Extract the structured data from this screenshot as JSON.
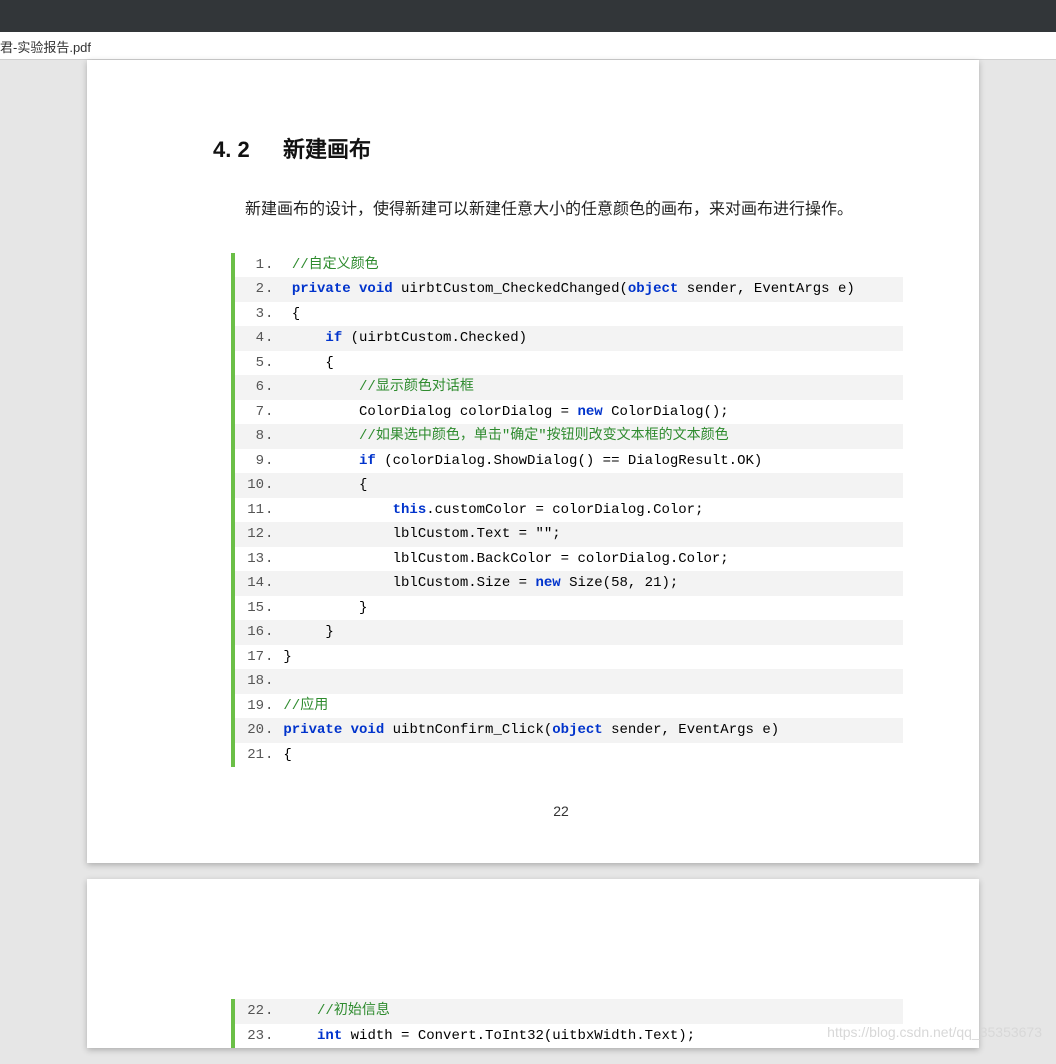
{
  "tab": {
    "filename_fragment": "君-实验报告.pdf"
  },
  "doc": {
    "section": {
      "number": "4. 2",
      "title": "新建画布"
    },
    "paragraph": "新建画布的设计，使得新建可以新建任意大小的任意颜色的画布，来对画布进行操作。",
    "page_number": "22",
    "code1": [
      {
        "n": "1",
        "alt": false,
        "tokens": [
          [
            "pl",
            "  "
          ],
          [
            "cm",
            "//自定义颜色"
          ]
        ]
      },
      {
        "n": "2",
        "alt": true,
        "tokens": [
          [
            "pl",
            "  "
          ],
          [
            "kw",
            "private"
          ],
          [
            "pl",
            " "
          ],
          [
            "kw",
            "void"
          ],
          [
            "pl",
            " uirbtCustom_CheckedChanged("
          ],
          [
            "kw",
            "object"
          ],
          [
            "pl",
            " sender, EventArgs e)"
          ]
        ]
      },
      {
        "n": "3",
        "alt": false,
        "tokens": [
          [
            "pl",
            "  {"
          ]
        ]
      },
      {
        "n": "4",
        "alt": true,
        "tokens": [
          [
            "pl",
            "      "
          ],
          [
            "kw",
            "if"
          ],
          [
            "pl",
            " (uirbtCustom.Checked)"
          ]
        ]
      },
      {
        "n": "5",
        "alt": false,
        "tokens": [
          [
            "pl",
            "      {"
          ]
        ]
      },
      {
        "n": "6",
        "alt": true,
        "tokens": [
          [
            "pl",
            "          "
          ],
          [
            "cm",
            "//显示颜色对话框"
          ]
        ]
      },
      {
        "n": "7",
        "alt": false,
        "tokens": [
          [
            "pl",
            "          ColorDialog colorDialog = "
          ],
          [
            "kw",
            "new"
          ],
          [
            "pl",
            " ColorDialog();"
          ]
        ]
      },
      {
        "n": "8",
        "alt": true,
        "tokens": [
          [
            "pl",
            "          "
          ],
          [
            "cm",
            "//如果选中颜色，单击\"确定\"按钮则改变文本框的文本颜色"
          ]
        ]
      },
      {
        "n": "9",
        "alt": false,
        "tokens": [
          [
            "pl",
            "          "
          ],
          [
            "kw",
            "if"
          ],
          [
            "pl",
            " (colorDialog.ShowDialog() == DialogResult.OK)"
          ]
        ]
      },
      {
        "n": "10",
        "alt": true,
        "tokens": [
          [
            "pl",
            "          {"
          ]
        ]
      },
      {
        "n": "11",
        "alt": false,
        "tokens": [
          [
            "pl",
            "              "
          ],
          [
            "kw",
            "this"
          ],
          [
            "pl",
            ".customColor = colorDialog.Color;"
          ]
        ]
      },
      {
        "n": "12",
        "alt": true,
        "tokens": [
          [
            "pl",
            "              lblCustom.Text = \"\";"
          ]
        ]
      },
      {
        "n": "13",
        "alt": false,
        "tokens": [
          [
            "pl",
            "              lblCustom.BackColor = colorDialog.Color;"
          ]
        ]
      },
      {
        "n": "14",
        "alt": true,
        "tokens": [
          [
            "pl",
            "              lblCustom.Size = "
          ],
          [
            "kw",
            "new"
          ],
          [
            "pl",
            " Size(58, 21);"
          ]
        ]
      },
      {
        "n": "15",
        "alt": false,
        "tokens": [
          [
            "pl",
            "          }"
          ]
        ]
      },
      {
        "n": "16",
        "alt": true,
        "tokens": [
          [
            "pl",
            "      }"
          ]
        ]
      },
      {
        "n": "17",
        "alt": false,
        "tokens": [
          [
            "pl",
            " }"
          ]
        ]
      },
      {
        "n": "18",
        "alt": true,
        "tokens": [
          [
            "pl",
            " "
          ]
        ]
      },
      {
        "n": "19",
        "alt": false,
        "tokens": [
          [
            "pl",
            " "
          ],
          [
            "cm",
            "//应用"
          ]
        ]
      },
      {
        "n": "20",
        "alt": true,
        "tokens": [
          [
            "pl",
            " "
          ],
          [
            "kw",
            "private"
          ],
          [
            "pl",
            " "
          ],
          [
            "kw",
            "void"
          ],
          [
            "pl",
            " uibtnConfirm_Click("
          ],
          [
            "kw",
            "object"
          ],
          [
            "pl",
            " sender, EventArgs e)"
          ]
        ]
      },
      {
        "n": "21",
        "alt": false,
        "tokens": [
          [
            "pl",
            " {"
          ]
        ]
      }
    ],
    "code2": [
      {
        "n": "22",
        "alt": true,
        "tokens": [
          [
            "pl",
            "     "
          ],
          [
            "cm",
            "//初始信息"
          ]
        ]
      },
      {
        "n": "23",
        "alt": false,
        "tokens": [
          [
            "pl",
            "     "
          ],
          [
            "kw",
            "int"
          ],
          [
            "pl",
            " width = Convert.ToInt32(uitbxWidth.Text);"
          ]
        ]
      }
    ]
  },
  "watermark": "https://blog.csdn.net/qq_35353673"
}
